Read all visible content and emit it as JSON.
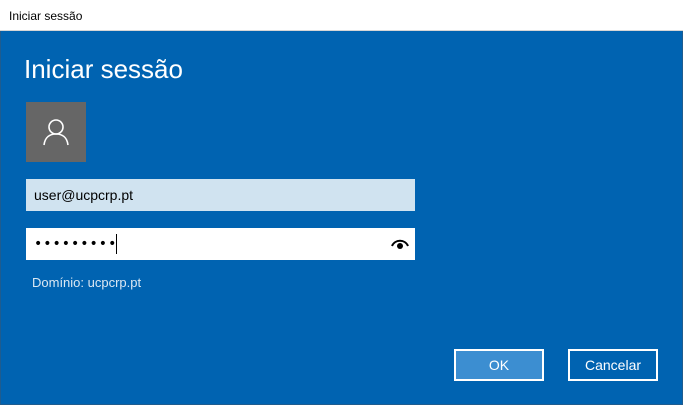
{
  "window": {
    "title": "Iniciar sessão"
  },
  "dialog": {
    "heading": "Iniciar sessão",
    "avatar_icon": "user-icon",
    "username": {
      "value": "user@ucpcrp.pt"
    },
    "password": {
      "value": "•••••••••",
      "reveal_icon": "eye-icon"
    },
    "domain_label": "Domínio: ucpcrp.pt",
    "ok_label": "OK",
    "cancel_label": "Cancelar"
  },
  "colors": {
    "background": "#0063b1",
    "ok_button": "#3c8ed1",
    "avatar": "#666666",
    "username_field": "#d0e3f0"
  }
}
